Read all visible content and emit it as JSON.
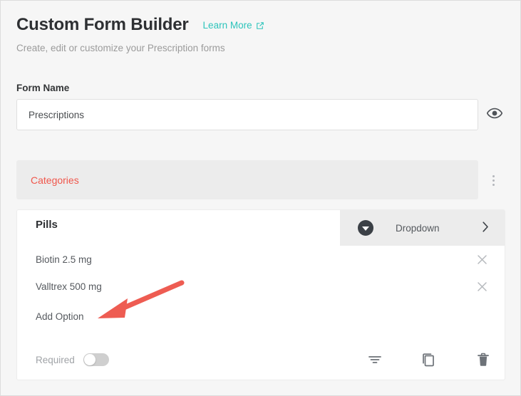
{
  "header": {
    "title": "Custom Form Builder",
    "learn_more": "Learn More",
    "learn_more_icon": "external-link-icon",
    "subtitle": "Create, edit or customize your Prescription forms"
  },
  "form_name": {
    "label": "Form Name",
    "value": "Prescriptions",
    "placeholder": "Form Name",
    "preview_icon": "eye-icon"
  },
  "categories": {
    "label": "Categories",
    "label_color": "#f0564b",
    "menu_icon": "kebab-menu-icon"
  },
  "field_card": {
    "title": "Pills",
    "type_selector": {
      "icon": "dropdown-circle-icon",
      "label": "Dropdown",
      "chevron": "chevron-right-icon"
    },
    "options": [
      {
        "text": "Biotin 2.5 mg",
        "remove_icon": "close-icon"
      },
      {
        "text": "Valltrex 500 mg",
        "remove_icon": "close-icon"
      }
    ],
    "add_option_label": "Add Option",
    "footer": {
      "required_label": "Required",
      "required_on": false,
      "actions": [
        {
          "icon": "filter-icon"
        },
        {
          "icon": "duplicate-icon"
        },
        {
          "icon": "trash-icon"
        }
      ]
    }
  },
  "annotation": {
    "arrow_color": "#ee5c52",
    "points_to": "Add Option"
  },
  "theme": {
    "accent": "#2dc4bb",
    "danger": "#f0564b",
    "page_bg": "#f6f6f6"
  }
}
